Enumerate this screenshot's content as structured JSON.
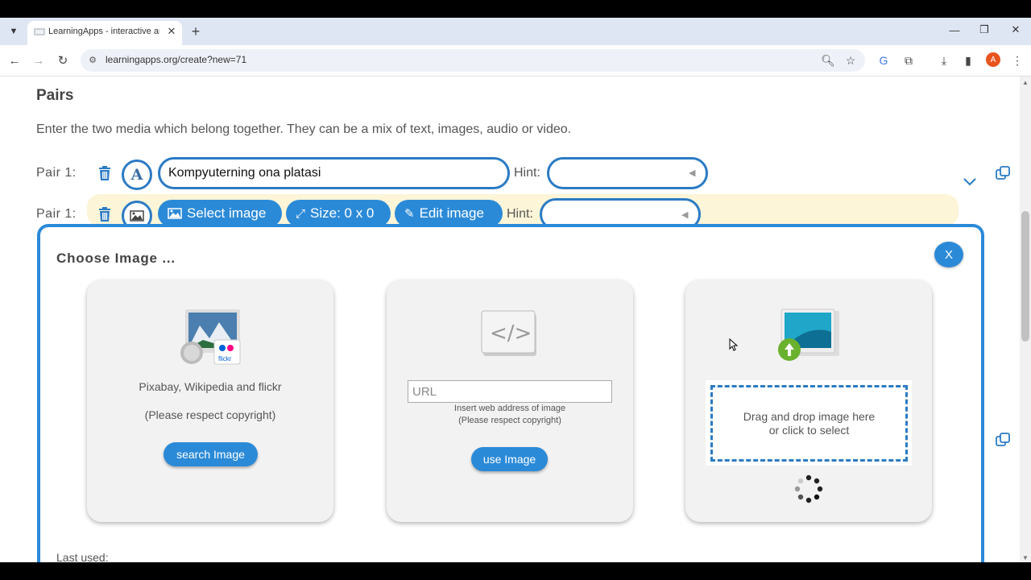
{
  "browser": {
    "tab_title": "LearningApps - interactive and",
    "url": "learningapps.org/create?new=71",
    "avatar_letter": "A"
  },
  "page": {
    "heading": "Pairs",
    "intro": "Enter the two media which belong together. They can be a mix of text, images, audio or video.",
    "pair1_label": "Pair 1:",
    "pair1_text": "Kompyuterning ona platasi",
    "hint_label": "Hint:",
    "pair1b_label": "Pair 1:",
    "select_image": "Select image",
    "size": "Size: 0 x 0",
    "edit_image": "Edit image",
    "hint_label2": "Hint:"
  },
  "dialog": {
    "title": "Choose Image ...",
    "close_label": "X",
    "card1": {
      "line1": "Pixabay, Wikipedia and flickr",
      "line2": "(Please respect copyright)",
      "button": "search Image"
    },
    "card2": {
      "placeholder": "URL",
      "note1": "Insert web address of image",
      "note2": "(Please respect copyright)",
      "button": "use Image"
    },
    "card3": {
      "drop1": "Drag and drop image here",
      "drop2": "or click to select"
    },
    "last_used": "Last used:"
  },
  "icons": {
    "trash": "trash-icon",
    "text_type": "text-type-icon",
    "image_type": "image-type-icon",
    "copy": "copy-icon",
    "chevron": "chevron-down-icon"
  },
  "colors": {
    "accent": "#2b8ad8",
    "border": "#2b7bc4",
    "row_highlight": "#fdf5d8"
  }
}
